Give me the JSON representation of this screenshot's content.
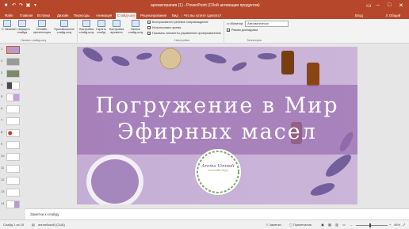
{
  "app": {
    "doc_title": "ароматерапия (1) - PowerPoint (Сбой активации продуктов)",
    "login": "Вход",
    "share": "Общий доступ"
  },
  "tabs": [
    {
      "label": "Файл"
    },
    {
      "label": "Главная"
    },
    {
      "label": "Вставка"
    },
    {
      "label": "Дизайн"
    },
    {
      "label": "Переходы"
    },
    {
      "label": "Анимация"
    },
    {
      "label": "Слайд-шоу"
    },
    {
      "label": "Рецензирование"
    },
    {
      "label": "Вид"
    }
  ],
  "tell_me": "Что вы хотите сделать?",
  "ribbon": {
    "buttons": [
      {
        "label": "С начала"
      },
      {
        "label": "С текущего слайда"
      },
      {
        "label": "Онлайн-презентация"
      },
      {
        "label": "Произвольное слайд-шоу"
      },
      {
        "label": "Настройка слайд-шоу"
      },
      {
        "label": "Скрыть слайд"
      },
      {
        "label": "Настройка времени"
      },
      {
        "label": "Запись слайд-шоу"
      }
    ],
    "group_start": "Начать слайд-шоу",
    "group_setup": "Настройка",
    "checks": [
      {
        "label": "Воспроизвести речевое сопровождение",
        "checked": true
      },
      {
        "label": "Использовать время",
        "checked": true
      },
      {
        "label": "Показать элементы управления проигрывателем",
        "checked": true
      }
    ],
    "monitor_label": "Монитор:",
    "monitor_value": "Автоматически",
    "presenter_view": "Режим докладчика",
    "group_monitors": "Мониторы"
  },
  "thumbnails": [
    {
      "num": "1"
    },
    {
      "num": "2"
    },
    {
      "num": "3"
    },
    {
      "num": "4"
    },
    {
      "num": "5"
    },
    {
      "num": "6"
    },
    {
      "num": "7"
    },
    {
      "num": "8"
    },
    {
      "num": "9"
    },
    {
      "num": "10"
    },
    {
      "num": "11"
    },
    {
      "num": "12"
    },
    {
      "num": "13"
    },
    {
      "num": "14"
    }
  ],
  "slide": {
    "title_line1": "Погружение в Мир",
    "title_line2": "Эфирных масел",
    "logo_line1": "Aroma Vinnedi",
    "logo_line2": "aromatherapy"
  },
  "notes_placeholder": "Заметки к слайду",
  "status": {
    "slide_info": "Слайд 1 из 15",
    "language": "английский (США)",
    "notes": "Заметки",
    "comments": "Примечания",
    "zoom": "45%"
  },
  "colors": {
    "accent": "#b7472a",
    "slide_band": "#9b6fb0"
  }
}
